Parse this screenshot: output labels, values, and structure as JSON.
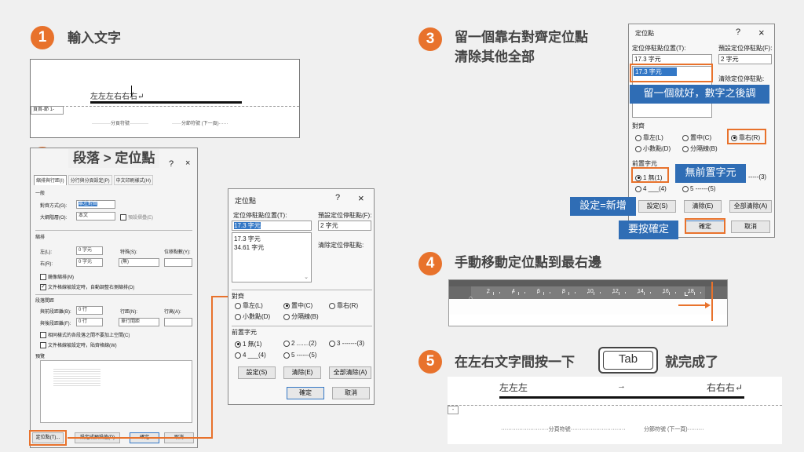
{
  "step1": {
    "num": "1",
    "title": "輸入文字",
    "doc_text": "左左左右右右↵",
    "section": "頁首-節 1-",
    "page_break": "分頁符號",
    "section_break": "分節符號 (下一頁)"
  },
  "step2": {
    "num": "2",
    "title": "段落 > 定位點",
    "para": {
      "close": "×",
      "help": "?",
      "tabs": [
        "縮排與行距(I)",
        "分行與分頁設定(P)",
        "中文印刷樣式(H)"
      ],
      "general": "一般",
      "align_label": "對齊方式(G):",
      "align_value": "靠左對齊",
      "outline_label": "大綱階層(O):",
      "outline_value": "本文",
      "collapse": "預設摺疊(E)",
      "indent": "縮排",
      "left": "左(L):",
      "left_v": "0 字元",
      "right": "右(R):",
      "right_v": "0 字元",
      "special": "特殊(S):",
      "special_v": "(無)",
      "by": "位移點數(Y):",
      "mirror": "鏡像縮排(M)",
      "auto": "文件格線被設定時，自動調整右側縮排(D)",
      "spacing": "段落間距",
      "before": "與前段距離(B):",
      "before_v": "0 行",
      "after": "與後段距離(F):",
      "after_v": "0 行",
      "line": "行距(N):",
      "line_v": "單行間距",
      "at": "行高(A):",
      "same": "相同樣式的各段落之間不要加上空間(C)",
      "grid": "文件格線被設定時，貼齊格線(W)",
      "preview": "預覽",
      "tabs_btn": "定位點(T)...",
      "default_btn": "設定成預設值(D)",
      "ok": "確定",
      "cancel": "取消"
    },
    "tabdlg": {
      "title": "定位點",
      "help": "?",
      "close": "×",
      "pos_label": "定位停駐點位置(T):",
      "pos_value": "17.3 字元",
      "list": [
        "17.3 字元",
        "34.61 字元"
      ],
      "default_label": "預設定位停駐點(F):",
      "default_value": "2 字元",
      "clear_label": "清除定位停駐點:",
      "align_title": "對齊",
      "align": [
        "靠左(L)",
        "置中(C)",
        "靠右(R)",
        "小數點(D)",
        "分隔線(B)"
      ],
      "leader_title": "前置字元",
      "leader": [
        "1 無(1)",
        "2 .......(2)",
        "3 -------(3)",
        "4 ___(4)",
        "5 ------(5)"
      ],
      "set": "設定(S)",
      "clear": "清除(E)",
      "clear_all": "全部清除(A)",
      "ok": "確定",
      "cancel": "取消"
    }
  },
  "step3": {
    "num": "3",
    "title_l1": "留一個靠右對齊定位點",
    "title_l2": "清除其他全部",
    "dlg": {
      "title": "定位點",
      "help": "?",
      "close": "×",
      "pos_label": "定位停駐點位置(T):",
      "pos_value": "17.3 字元",
      "list": [
        "17.3 字元"
      ],
      "default_label": "預設定位停駐點(F):",
      "default_value": "2 字元",
      "clear_label": "清除定位停駐點:",
      "align_title": "對齊",
      "align": [
        "靠左(L)",
        "置中(C)",
        "靠右(R)",
        "小數點(D)",
        "分隔線(B)"
      ],
      "leader_title": "前置字元",
      "leader": [
        "1 無(1)",
        "-----(3)",
        "4 ___(4)",
        "5 ------(5)"
      ],
      "set": "設定(S)",
      "clear": "清除(E)",
      "clear_all": "全部清除(A)",
      "ok": "確定",
      "cancel": "取消"
    },
    "callouts": {
      "keep": "留一個就好，數字之後調",
      "no_leader": "無前置字元",
      "set_new": "設定=新增",
      "press_ok": "要按確定"
    }
  },
  "step4": {
    "num": "4",
    "title": "手動移動定位點到最右邊",
    "ruler_ticks": [
      "2",
      "4",
      "6",
      "8",
      "10",
      "12",
      "14",
      "16",
      "18"
    ]
  },
  "step5": {
    "num": "5",
    "title_pre": "在左右文字間按一下",
    "key": "Tab",
    "title_post": "就完成了",
    "left_text": "左左左",
    "arrow": "→",
    "right_text": "右右右↵",
    "page_break": "分頁符號",
    "section_break": "分節符號 (下一頁)"
  },
  "colors": {
    "accent": "#e8722c",
    "callout": "#2f6db5",
    "background": "#f0f0f0"
  }
}
